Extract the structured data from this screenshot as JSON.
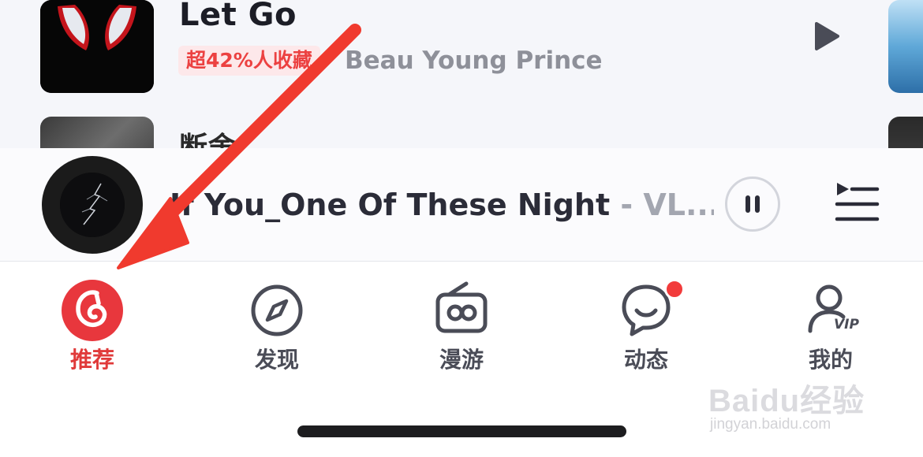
{
  "song_list": {
    "items": [
      {
        "title": "Let Go",
        "badge": "超42%人收藏",
        "artist": "Beau Young Prince",
        "cover_icon": "spider-mask-cover",
        "action_icon": "play-icon"
      },
      {
        "title": "断舍",
        "cover_icon": "portrait-cover"
      }
    ]
  },
  "mini_player": {
    "track": "If You_One Of These Night",
    "artist_suffix": " - VL...",
    "disc_icon": "album-disc",
    "pause_icon": "pause-icon",
    "queue_icon": "playlist-queue-icon"
  },
  "tab_bar": {
    "tabs": [
      {
        "label": "推荐",
        "icon": "netease-music-logo-icon",
        "active": true
      },
      {
        "label": "发现",
        "icon": "compass-icon",
        "active": false
      },
      {
        "label": "漫游",
        "icon": "radio-icon",
        "active": false
      },
      {
        "label": "动态",
        "icon": "chat-bubble-icon",
        "active": false,
        "badge_dot": true
      },
      {
        "label": "我的",
        "icon": "user-vip-icon",
        "active": false,
        "vip_text": "VIP"
      }
    ]
  },
  "colors": {
    "accent": "#ec4141",
    "text_primary": "#1c1d26",
    "text_secondary": "#8e9099",
    "annotation_arrow": "#f03a2e"
  },
  "watermark": {
    "brand": "Baidu经验",
    "url": "jingyan.baidu.com"
  }
}
